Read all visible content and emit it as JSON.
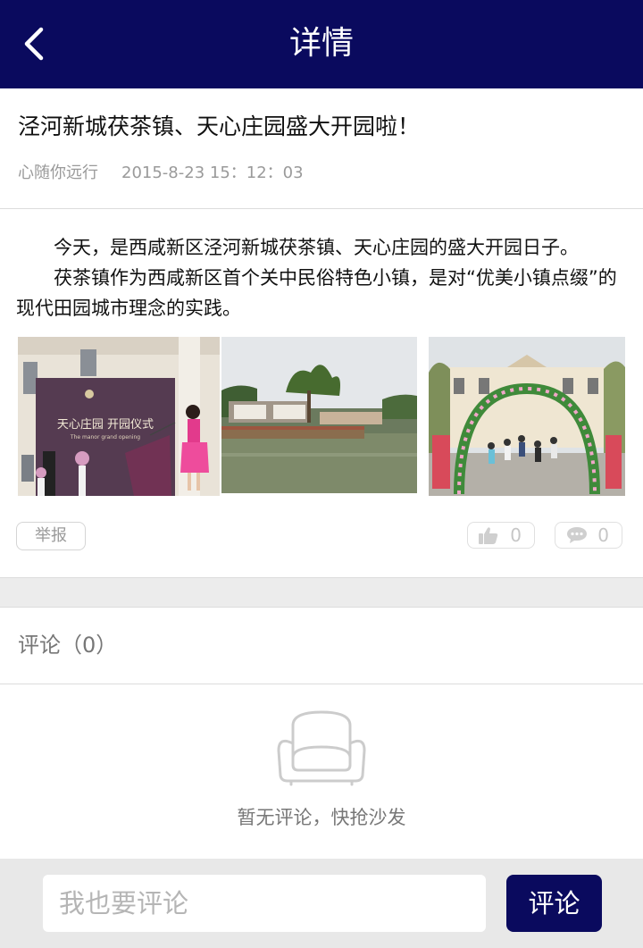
{
  "header": {
    "title": "详情",
    "back_icon": "chevron-left-icon"
  },
  "article": {
    "title": "泾河新城茯茶镇、天心庄园盛大开园啦！",
    "author": "心随你远行",
    "date": "2015-8-23  15：12：03",
    "paragraphs": [
      "今天，是西咸新区泾河新城茯茶镇、天心庄园的盛大开园日子。",
      "茯茶镇作为西咸新区首个关中民俗特色小镇，是对“优美小镇点缀”的现代田园城市理念的实践。"
    ],
    "photos": [
      {
        "sign_line1": "天心庄园  开园仪式",
        "sign_line2": "The manor grand opening"
      },
      {},
      {}
    ]
  },
  "actions": {
    "report_label": "举报",
    "like_icon": "thumbs-up-icon",
    "like_count": "0",
    "comment_icon": "speech-bubble-icon",
    "comment_count": "0"
  },
  "comments": {
    "heading": "评论（0）",
    "empty_icon": "sofa-icon",
    "empty_text": "暂无评论，快抢沙发"
  },
  "input": {
    "placeholder": "我也要评论",
    "submit_label": "评论"
  },
  "colors": {
    "brand": "#0a0a5e",
    "band": "#ececec",
    "muted": "#9a9a9a"
  }
}
